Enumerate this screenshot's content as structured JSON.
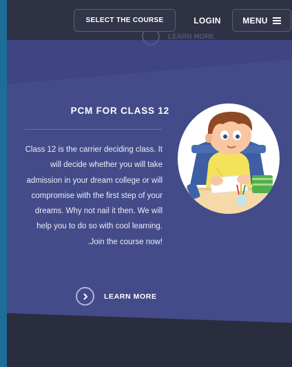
{
  "nav": {
    "select_course_label": "SELECT THE COURSE",
    "login_label": "LOGIN",
    "menu_label": "MENU"
  },
  "ghost": {
    "learn_more_label": "LEARN MORE"
  },
  "section": {
    "title": "PCM FOR CLASS 12",
    "description": "Class 12 is the carrier deciding class. It will decide whether you will take admission in your dream college or will compromise with the first step of your dreams. Why not nail it then. We will help you to do so with cool learning. .Join the course now!",
    "learn_more_label": "LEARN MORE"
  },
  "colors": {
    "main_panel": "#434b89",
    "footer": "#2a2d3e",
    "left_edge": "#1c6e98"
  },
  "icons": {
    "menu": "hamburger-icon",
    "learn_more": "chevron-right-icon",
    "illustration": "boy-studying-illustration"
  }
}
